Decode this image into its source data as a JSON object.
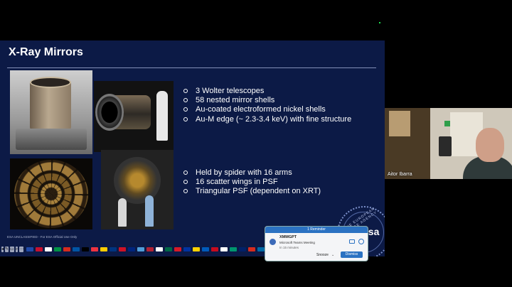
{
  "slide": {
    "title": "X-Ray Mirrors",
    "bullets_top": [
      "3 Wolter telescopes",
      "58 nested mirror shells",
      "Au-coated electroformed nickel shells",
      "Au-M edge (~ 2.3-3.4 keV)  with fine structure"
    ],
    "bullets_bottom": [
      "Held by spider with 16 arms",
      "16 scatter wings in PSF",
      "Triangular PSF (dependent on XRT)"
    ],
    "classification": "ESA UNCLASSIFIED - For ESA Official Use Only",
    "seal_text": "THE EUROPEAN SPACE AGENCY",
    "logo_text": "esa"
  },
  "participant": {
    "name": "Aitor Ibarra"
  },
  "reminder": {
    "header": "1 Reminder",
    "title": "XMMGPT",
    "subtitle": "Microsoft Teams Meeting",
    "time": "In 15 minutes",
    "snooze_label": "Snooze",
    "dismiss_label": "Dismiss"
  },
  "toolbar_tools": [
    "◂",
    "✎",
    "▭",
    "⌕",
    "⋯"
  ],
  "flag_colors": [
    "#1f4aa8",
    "#c8102e",
    "#ffffff",
    "#009246",
    "#d52b1e",
    "#0055a4",
    "#000000",
    "#ef3340",
    "#ffcc00",
    "#003580",
    "#ce1126",
    "#00247d",
    "#4f9dd8",
    "#b22234",
    "#ffffff",
    "#006847",
    "#d71a28",
    "#0033a0",
    "#ffd100",
    "#005bbb",
    "#c60b1e",
    "#ffffff",
    "#00966e",
    "#012169",
    "#d52b1e",
    "#006aa7",
    "#ed2939"
  ],
  "colors": {
    "slide_bg": "#0c1a46",
    "accent": "#2b72c2"
  }
}
